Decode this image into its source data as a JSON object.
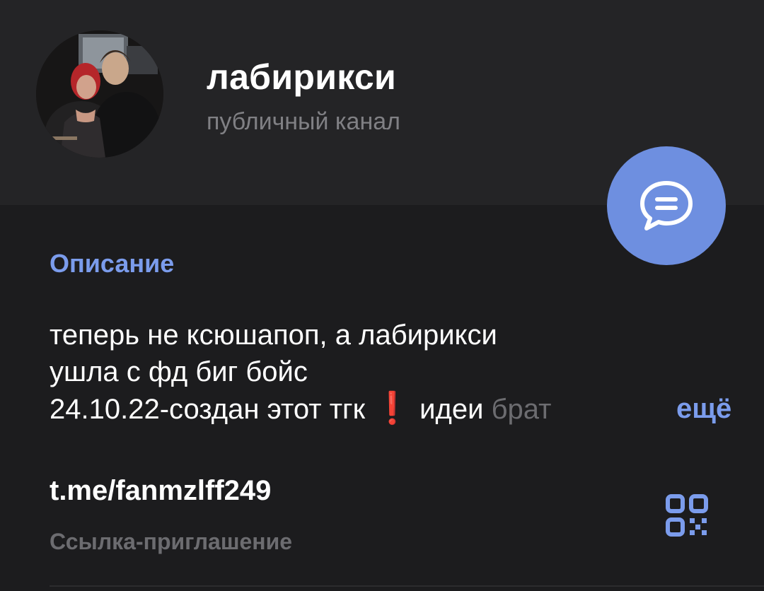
{
  "header": {
    "channel_name": "лабирикси",
    "channel_type": "публичный канал"
  },
  "avatar": {
    "icon": "channel-avatar-photo"
  },
  "fab": {
    "icon": "chat-bubble-icon",
    "color": "#6e8fe0"
  },
  "description": {
    "title": "Описание",
    "lines": [
      "теперь не ксюшапоп, а лабирикси",
      "ушла с фд биг бойс"
    ],
    "line3_prefix": "24.10.22-создан этот тгк",
    "line3_emoji": "❗",
    "line3_suffix": " идеи ",
    "line3_faded": "брат",
    "more_label": "ещё"
  },
  "invite": {
    "link": "t.me/fanmzlff249",
    "caption": "Ссылка-приглашение",
    "qr_icon": "qr-code-icon"
  },
  "colors": {
    "accent": "#7b9cec",
    "background": "#1c1c1e",
    "header_background": "#242426",
    "secondary_text": "#808084",
    "emoji_red": "#e1251b"
  }
}
